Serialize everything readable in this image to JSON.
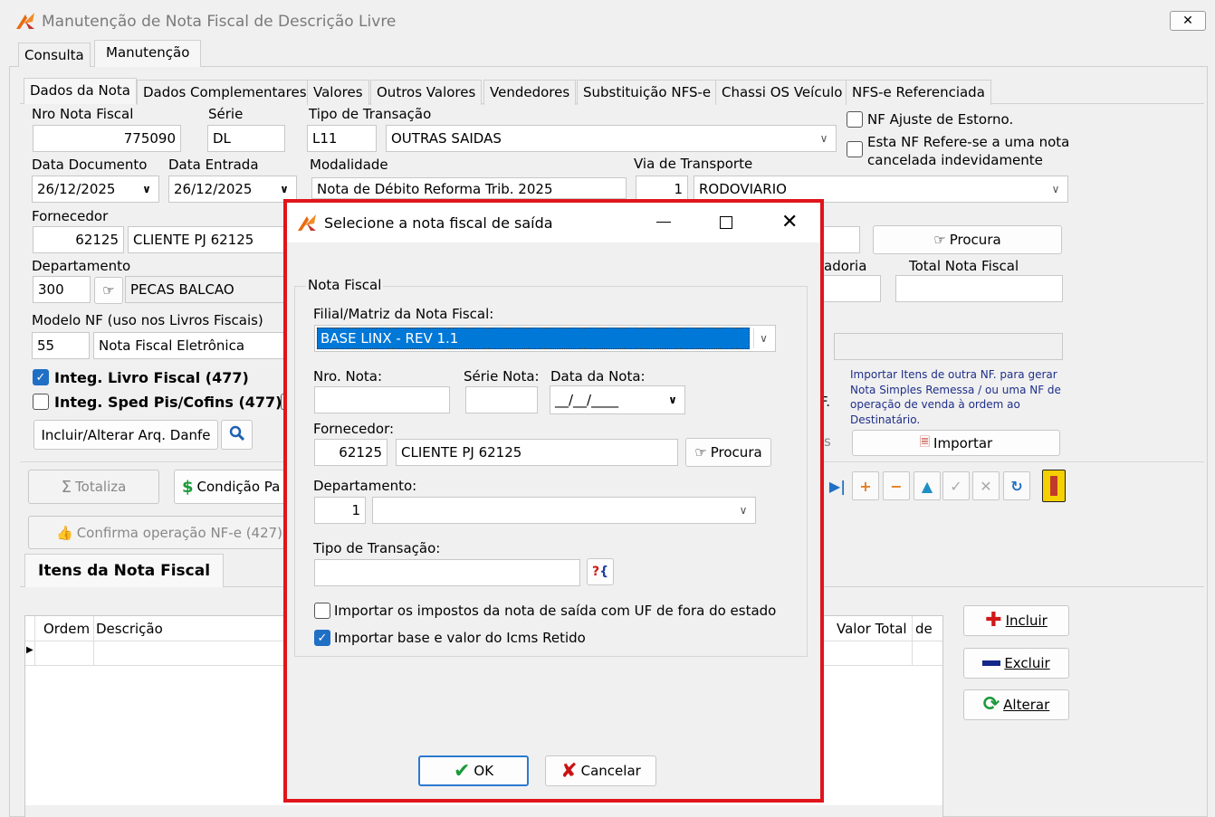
{
  "window": {
    "title": "Manutenção de Nota Fiscal de Descrição Livre",
    "close_glyph": "✕"
  },
  "main_tabs": [
    "Consulta",
    "Manutenção"
  ],
  "sub_tabs": [
    "Dados da Nota",
    "Dados Complementares",
    "Valores",
    "Outros Valores",
    "Vendedores",
    "Substituição NFS-e",
    "Chassi OS Veículo",
    "NFS-e Referenciada"
  ],
  "form": {
    "nro_nota_label": "Nro Nota Fiscal",
    "nro_nota_value": "775090",
    "serie_label": "Série",
    "serie_value": "DL",
    "tipo_transacao_label": "Tipo de Transação",
    "tipo_transacao_code": "L11",
    "tipo_transacao_value": "OUTRAS SAIDAS",
    "nf_ajuste_label": "NF Ajuste de Estorno.",
    "nf_refere_label": "Esta NF Refere-se a uma nota cancelada indevidamente",
    "data_documento_label": "Data Documento",
    "data_documento_value": "26/12/2025",
    "data_entrada_label": "Data Entrada",
    "data_entrada_value": "26/12/2025",
    "modalidade_label": "Modalidade",
    "modalidade_value": "Nota de Débito Reforma Trib. 2025",
    "via_transporte_label": "Via de Transporte",
    "via_transporte_code": "1",
    "via_transporte_value": "RODOVIARIO",
    "fornecedor_label": "Fornecedor",
    "fornecedor_code": "62125",
    "fornecedor_name": "CLIENTE PJ 62125",
    "procura_label": "Procura",
    "departamento_label": "Departamento",
    "departamento_code": "300",
    "departamento_name": "PECAS BALCAO",
    "mercadoria_label_partial": "adoria",
    "total_nota_label": "Total Nota Fiscal",
    "modelo_nf_label": "Modelo NF (uso nos Livros Fiscais)",
    "modelo_nf_code": "55",
    "modelo_nf_value": "Nota Fiscal Eletrônica",
    "integ_livro_label": "Integ. Livro Fiscal (477)",
    "integ_sped_label": "Integ. Sped Pis/Cofins (477)",
    "nf_partial": "F.",
    "s_partial": "s",
    "importar_info": "Importar Itens de outra NF. para gerar Nota Simples Remessa / ou uma NF de operação de venda à ordem ao Destinatário.",
    "importar_label": "Importar",
    "incluir_arq_danfe": "Incluir/Alterar Arq. Danfe"
  },
  "actions": {
    "totaliza": "Totaliza",
    "condicao_pag": "Condição Pa",
    "confirma_operacao": "Confirma operação NF-e (427)"
  },
  "items": {
    "tab_label": "Itens da Nota Fiscal",
    "columns": [
      "Ordem",
      "Descrição",
      "Valor Total",
      "de"
    ],
    "incluir": "Incluir",
    "excluir": "Excluir",
    "alterar": "Alterar"
  },
  "dialog": {
    "title": "Selecione a nota fiscal de saída",
    "group_label": "Nota Fiscal",
    "filial_label": "Filial/Matriz da Nota Fiscal:",
    "filial_value": "BASE LINX - REV 1.1",
    "nro_nota_label": "Nro. Nota:",
    "nro_nota_value": "",
    "serie_nota_label": "Série Nota:",
    "serie_nota_value": "",
    "data_nota_label": "Data da Nota:",
    "data_nota_value": "__/__/____",
    "fornecedor_label": "Fornecedor:",
    "fornecedor_code": "62125",
    "fornecedor_name": "CLIENTE PJ 62125",
    "procura_label": "Procura",
    "departamento_label": "Departamento:",
    "departamento_code": "1",
    "departamento_name": "",
    "tipo_transacao_label": "Tipo de Transação:",
    "tipo_transacao_value": "",
    "importar_impostos_label": "Importar os impostos da nota de saída com UF de fora do estado",
    "importar_impostos_checked": false,
    "importar_icms_label": "Importar base e valor do Icms Retido",
    "importar_icms_checked": true,
    "ok_label": "OK",
    "cancelar_label": "Cancelar"
  },
  "colors": {
    "highlight_frame": "#e0151b",
    "selection_blue": "#0078d7",
    "checkbox_blue": "#1f6fc5"
  }
}
